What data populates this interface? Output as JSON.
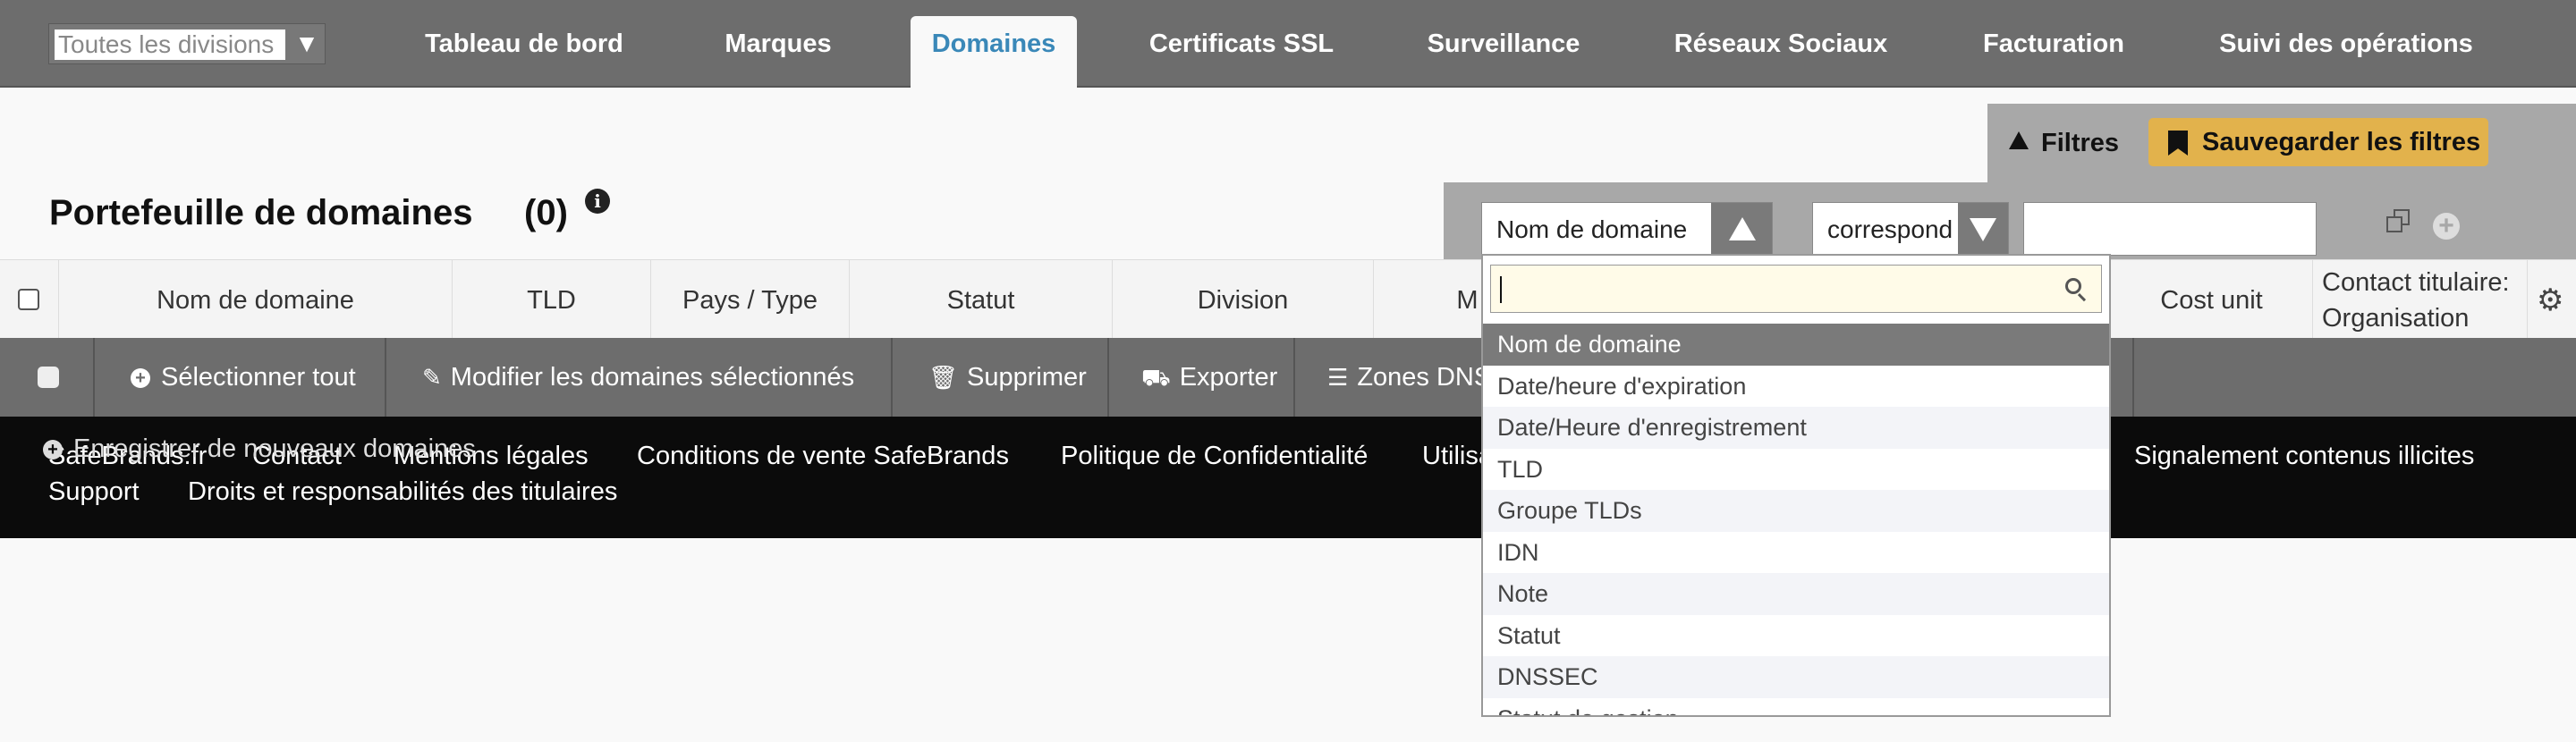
{
  "topnav": {
    "division_placeholder": "Toutes les divisions",
    "tabs": [
      {
        "label": "Tableau de bord"
      },
      {
        "label": "Marques"
      },
      {
        "label": "Domaines",
        "active": true
      },
      {
        "label": "Certificats SSL"
      },
      {
        "label": "Surveillance"
      },
      {
        "label": "Réseaux Sociaux"
      },
      {
        "label": "Facturation"
      },
      {
        "label": "Suivi des opérations"
      }
    ]
  },
  "page": {
    "title": "Portefeuille de domaines",
    "count": "(0)"
  },
  "filters": {
    "toggle_label": "Filtres",
    "save_label": "Sauvegarder les filtres",
    "field_value": "Nom de domaine",
    "operator_value": "correspond à",
    "value_input": ""
  },
  "table": {
    "columns": [
      "Nom de domaine",
      "TLD",
      "Pays / Type",
      "Statut",
      "Division",
      "M",
      "Cost unit",
      "Contact titulaire: Organisation"
    ]
  },
  "actions": {
    "select_all": "Sélectionner tout",
    "edit_selected": "Modifier les domaines sélectionnés",
    "delete": "Supprimer",
    "export": "Exporter",
    "dns_zones": "Zones DNS",
    "register_new": "Enregistrer de nouveaux domaines"
  },
  "footer": {
    "links": [
      "SafeBrands.fr",
      "Contact",
      "Mentions légales",
      "Conditions de vente SafeBrands",
      "Politique de Confidentialité",
      "Utilisa",
      "Signalement contenus illicites",
      "Support",
      "Droits et responsabilités des titulaires"
    ]
  },
  "dropdown": {
    "search_value": "",
    "options": [
      "Nom de domaine",
      "Date/heure d'expiration",
      "Date/Heure d'enregistrement",
      "TLD",
      "Groupe TLDs",
      "IDN",
      "Note",
      "Statut",
      "DNSSEC",
      "Statut de gestion"
    ],
    "selected_index": 0
  },
  "colors": {
    "nav_bg": "#6d6d6d",
    "active_tab_text": "#3a88b8",
    "save_button": "#e2b24c",
    "footer_bg": "#0b0b0b"
  }
}
